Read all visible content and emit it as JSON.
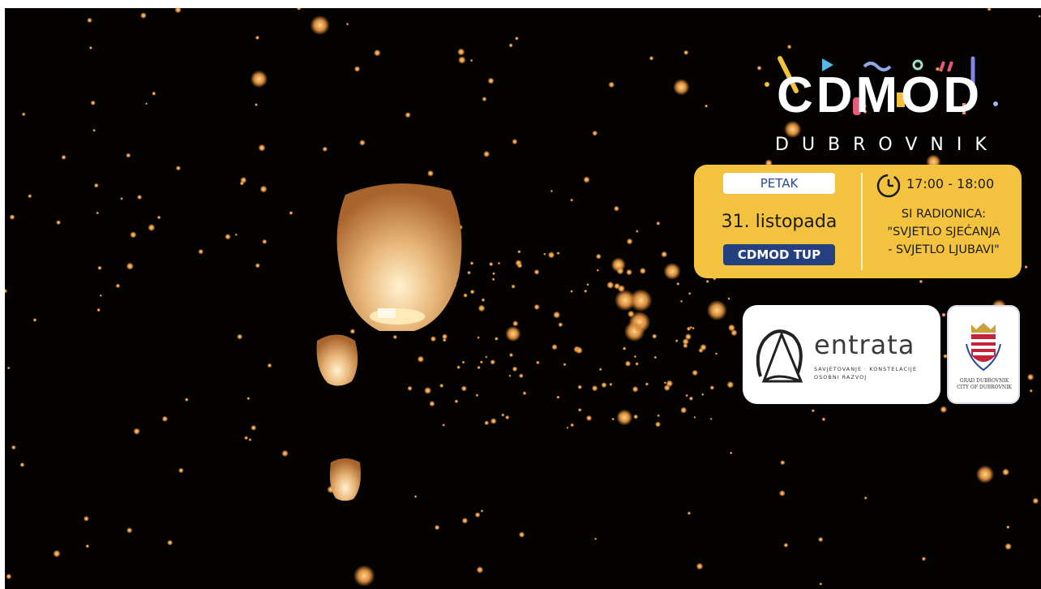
{
  "logo": {
    "word": "CDMOD",
    "subtitle": "DUBROVNIK",
    "icon": "cdmod-logo"
  },
  "event": {
    "day": "PETAK",
    "date": "31. listopada",
    "location": "CDMOD TUP",
    "time": "17:00 - 18:00",
    "title_lines": [
      "SI RADIONICA:",
      "\"SVJETLO SJEĆANJA",
      "- SVJETLO LJUBAVI\""
    ],
    "time_icon": "clock-icon"
  },
  "partner": {
    "name": "entrata",
    "tagline": "SAVJETOVANJE · KONSTELACIJE\nOSOBNI RAZVOJ",
    "icon": "entrata-logo"
  },
  "city": {
    "name": "GRAD DUBROVNIK\nCITY OF DUBROVNIK",
    "icon": "dubrovnik-coat-of-arms"
  },
  "colors": {
    "card": "#f3c23f",
    "navy": "#24407f",
    "sky": "#050302",
    "lantern": "#e8a65a"
  }
}
